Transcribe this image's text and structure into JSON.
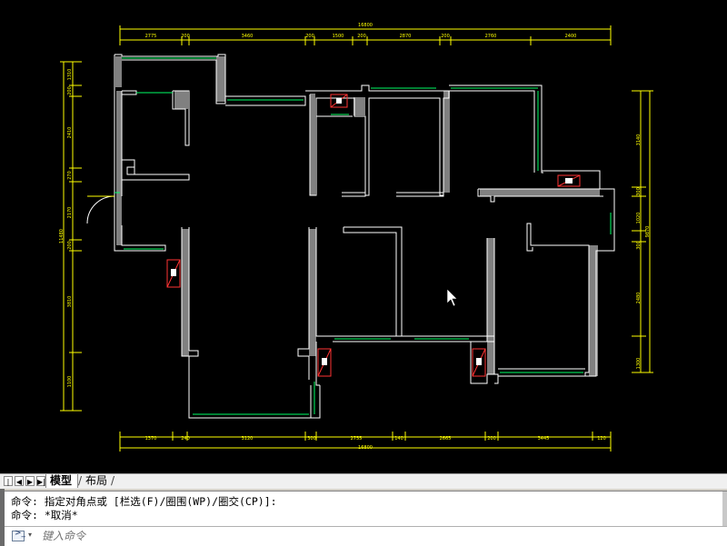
{
  "dimensions": {
    "top_total": "16800",
    "top": [
      "2775",
      "200",
      "3460",
      "200",
      "1500",
      "200",
      "2870",
      "200",
      "2760",
      "2400"
    ],
    "bottom_total": "16800",
    "bottom": [
      "1370",
      "240",
      "3120",
      "300",
      "2755",
      "140",
      "2665",
      "200",
      "3445",
      "120"
    ],
    "left_total": "11480",
    "left": [
      "1310",
      "200",
      "2410",
      "270",
      "2170",
      "200",
      "3810",
      "1100"
    ],
    "right_total": "9870",
    "right": [
      "3140",
      "300",
      "1020",
      "300",
      "2480",
      "1300"
    ]
  },
  "tabs": {
    "model": "模型",
    "layout": "布局"
  },
  "command": {
    "history": [
      "命令: 指定对角点或 [栏选(F)/圈围(WP)/圈交(CP)]:",
      "命令: *取消*"
    ],
    "placeholder": "键入命令"
  },
  "colors": {
    "wall": "#ffffff",
    "wall_fill": "#808080",
    "dimension": "#ffff00",
    "window": "#00ff66",
    "duct": "#ff3333",
    "background": "#000000"
  }
}
